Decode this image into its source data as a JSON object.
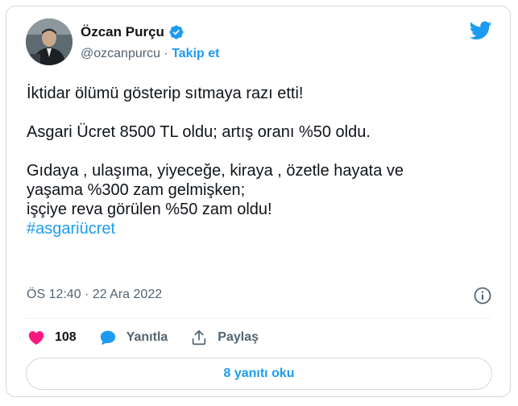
{
  "author": {
    "name": "Özcan Purçu",
    "handle": "@ozcanpurcu",
    "separator": " · ",
    "follow_label": "Takip et"
  },
  "tweet": {
    "lines_p1": [
      "İktidar ölümü gösterip sıtmaya razı etti!"
    ],
    "lines_p2": [
      "Asgari Ücret 8500 TL oldu; artış oranı %50 oldu."
    ],
    "lines_p3": [
      "Gıdaya , ulaşıma, yiyeceğe, kiraya , özetle hayata ve",
      "yaşama %300 zam gelmişken;",
      "işçiye reva görülen %50 zam oldu!"
    ],
    "hashtag": "#asgariücret"
  },
  "meta": {
    "timestamp": "ÖS 12:40 · 22 Ara 2022"
  },
  "actions": {
    "like_count": "108",
    "reply_label": "Yanıtla",
    "share_label": "Paylaş"
  },
  "read_replies_label": "8 yanıtı oku",
  "colors": {
    "accent": "#1d9bf0",
    "like": "#f91880",
    "text": "#0f1419",
    "muted": "#536471",
    "border": "#cfd9de"
  },
  "icons": [
    "verified-badge-icon",
    "twitter-bird-icon",
    "info-icon",
    "heart-icon",
    "reply-bubble-icon",
    "share-icon"
  ]
}
